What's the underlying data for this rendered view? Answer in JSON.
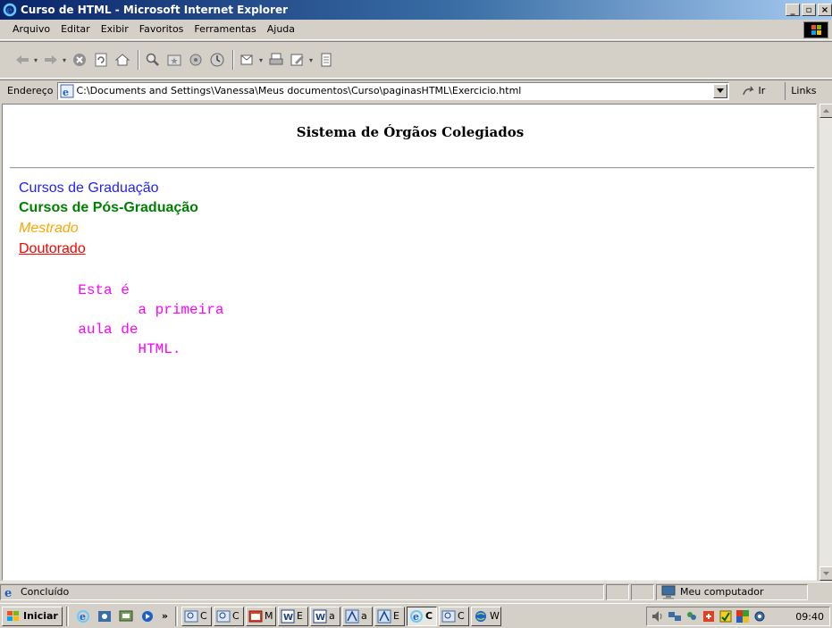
{
  "window": {
    "title": "Curso de HTML - Microsoft Internet Explorer",
    "buttons": {
      "minimize": "_",
      "maximize": "▫",
      "close": "×"
    }
  },
  "menubar": {
    "items": [
      {
        "label": "Arquivo"
      },
      {
        "label": "Editar"
      },
      {
        "label": "Exibir"
      },
      {
        "label": "Favoritos"
      },
      {
        "label": "Ferramentas"
      },
      {
        "label": "Ajuda"
      }
    ]
  },
  "addressbar": {
    "label": "Endereço",
    "url": "C:\\Documents and Settings\\Vanessa\\Meus documentos\\Curso\\paginasHTML\\Exercicio.html",
    "go_label": "Ir",
    "links_label": "Links"
  },
  "page": {
    "title": "Sistema de Órgãos Colegiados",
    "links": [
      {
        "label": "Cursos de Graduação",
        "color": "#1f1fff"
      },
      {
        "label": "Cursos de Pós-Graduação",
        "color": "#008000"
      },
      {
        "label": "Mestrado",
        "color": "#ffa500"
      },
      {
        "label": "Doutorado",
        "color": "#ff0000"
      }
    ],
    "preformatted": "       Esta é\n              a primeira\n       aula de\n              HTML.",
    "preformatted_color": "#ff00ff"
  },
  "statusbar": {
    "status": "Concluído",
    "zone": "Meu computador"
  },
  "taskbar": {
    "start_label": "Iniciar",
    "chevron": "»",
    "tasks": [
      {
        "label": "C",
        "icon": "search-icon"
      },
      {
        "label": "C",
        "icon": "search-icon"
      },
      {
        "label": "M",
        "icon": "window-icon"
      },
      {
        "label": "E",
        "icon": "word-icon"
      },
      {
        "label": "a",
        "icon": "word-icon"
      },
      {
        "label": "a",
        "icon": "frontpage-icon"
      },
      {
        "label": "E",
        "icon": "frontpage-icon"
      },
      {
        "label": "C",
        "icon": "ie-icon",
        "active": true
      },
      {
        "label": "C",
        "icon": "search-icon"
      },
      {
        "label": "W",
        "icon": "globe-icon"
      }
    ],
    "clock": "09:40"
  }
}
